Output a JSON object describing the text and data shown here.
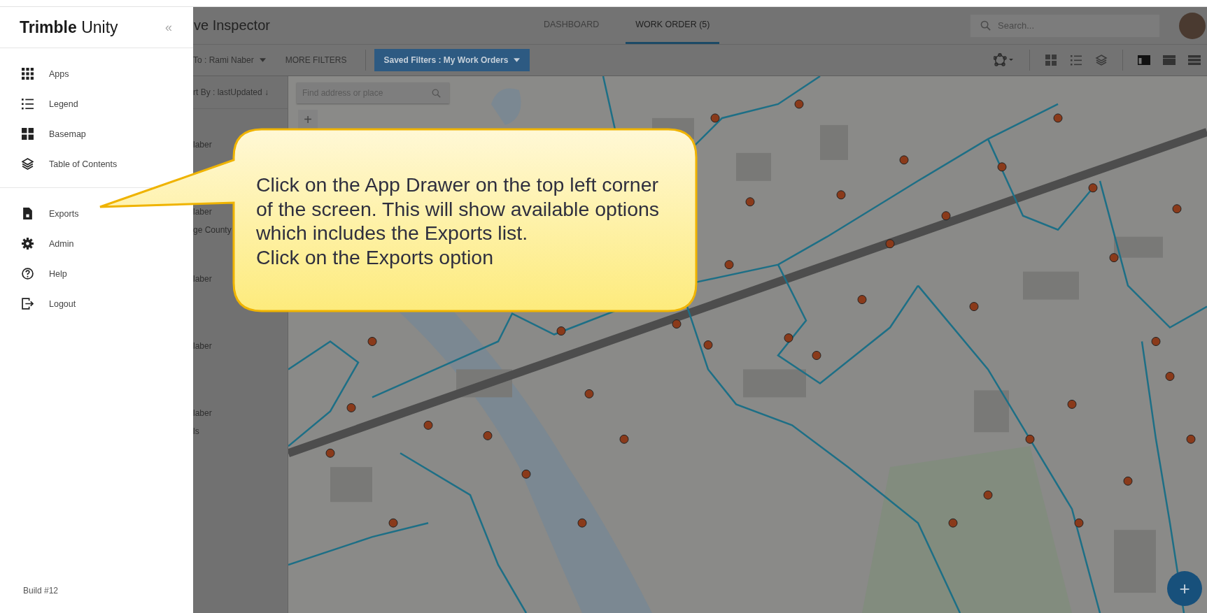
{
  "drawer": {
    "brand_bold": "Trimble",
    "brand_light": "Unity",
    "collapse": "«",
    "groups": [
      [
        {
          "label": "Apps",
          "kind": "apps"
        },
        {
          "label": "Legend",
          "kind": "legend"
        },
        {
          "label": "Basemap",
          "kind": "basemap"
        },
        {
          "label": "Table of Contents",
          "kind": "layers"
        }
      ],
      [
        {
          "label": "Exports",
          "kind": "exports"
        },
        {
          "label": "Admin",
          "kind": "admin"
        },
        {
          "label": "Help",
          "kind": "help"
        },
        {
          "label": "Logout",
          "kind": "logout"
        }
      ]
    ],
    "build": "Build #12"
  },
  "app": {
    "title": "ve Inspector",
    "tabs": [
      {
        "label": "DASHBOARD",
        "selected": false
      },
      {
        "label": "WORK ORDER (5)",
        "selected": true
      }
    ],
    "search": {
      "placeholder": "Search..."
    },
    "filters": {
      "assigned": "To : Rami Naber",
      "more": "MORE FILTERS",
      "saved": "Saved Filters : My Work Orders"
    },
    "list": {
      "sort": "rt By : lastUpdated ↓",
      "rows": [
        [
          "laber"
        ],
        [
          "laber",
          "ge County"
        ],
        [
          "laber"
        ],
        [
          "laber"
        ],
        [
          "laber",
          "ls"
        ]
      ]
    },
    "map": {
      "find_placeholder": "Find address or place",
      "zoom_in": "+",
      "fab": "+"
    }
  },
  "callout": {
    "paragraphs": [
      "Click on the App Drawer on the top left corner of the screen. This will show available options which includes the Exports list.",
      "Click on the Exports option"
    ]
  }
}
